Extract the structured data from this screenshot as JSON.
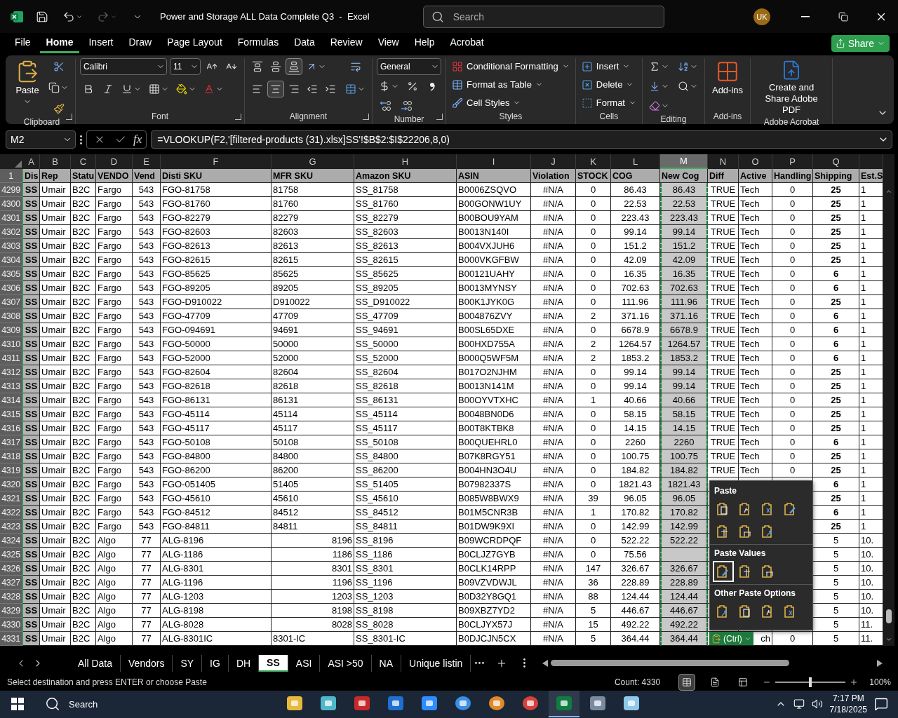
{
  "window": {
    "title": "Power and Storage ALL Data Complete Q3  -  Excel",
    "search_placeholder": "Search",
    "avatar": "UK"
  },
  "menu_tabs": [
    {
      "label": "File",
      "selected": false
    },
    {
      "label": "Home",
      "selected": true
    },
    {
      "label": "Insert",
      "selected": false
    },
    {
      "label": "Draw",
      "selected": false
    },
    {
      "label": "Page Layout",
      "selected": false
    },
    {
      "label": "Formulas",
      "selected": false
    },
    {
      "label": "Data",
      "selected": false
    },
    {
      "label": "Review",
      "selected": false
    },
    {
      "label": "View",
      "selected": false
    },
    {
      "label": "Help",
      "selected": false
    },
    {
      "label": "Acrobat",
      "selected": false
    }
  ],
  "share": "Share",
  "ribbon": [
    {
      "kind": "clipboard",
      "label": "Clipboard",
      "button": "Paste"
    },
    {
      "kind": "font",
      "label": "Font",
      "font_name": "Calibri",
      "font_size": "11"
    },
    {
      "kind": "alignment",
      "label": "Alignment",
      "buttons": [
        {
          "kind": "top",
          "on": false
        },
        {
          "kind": "middle",
          "on": false
        },
        {
          "kind": "bottom",
          "on": true
        },
        {
          "kind": "left",
          "on": false
        },
        {
          "kind": "center",
          "on": true
        },
        {
          "kind": "right",
          "on": false
        },
        {
          "kind": "outdent",
          "on": false
        },
        {
          "kind": "indent",
          "on": false
        }
      ]
    },
    {
      "kind": "number",
      "label": "Number",
      "format": "General"
    },
    {
      "kind": "styles",
      "label": "Styles",
      "items": [
        "Conditional Formatting",
        "Format as Table",
        "Cell Styles"
      ]
    },
    {
      "kind": "cells",
      "label": "Cells",
      "items": [
        "Insert",
        "Delete",
        "Format"
      ]
    },
    {
      "kind": "editing",
      "label": "Editing"
    },
    {
      "kind": "addins",
      "label": "Add-ins",
      "button": "Add-ins"
    },
    {
      "kind": "acrobat",
      "label": "Adobe Acrobat",
      "button": "Create and Share Adobe PDF"
    }
  ],
  "formula_bar": {
    "name_box": "M2",
    "fx": "fx",
    "formula": "=VLOOKUP(F2,'[filtered-products (31).xlsx]SS'!$B$2:$I$22206,8,0)"
  },
  "sheet": {
    "columns": [
      {
        "letter": "A",
        "header": "Dis",
        "selected": false
      },
      {
        "letter": "B",
        "header": "Rep",
        "selected": false
      },
      {
        "letter": "C",
        "header": "Statu",
        "selected": false
      },
      {
        "letter": "D",
        "header": "VENDO",
        "selected": false
      },
      {
        "letter": "E",
        "header": "Vend",
        "selected": false
      },
      {
        "letter": "F",
        "header": "Disti SKU",
        "selected": false
      },
      {
        "letter": "G",
        "header": "MFR SKU",
        "selected": false
      },
      {
        "letter": "H",
        "header": "Amazon SKU",
        "selected": false
      },
      {
        "letter": "I",
        "header": "ASIN",
        "selected": false
      },
      {
        "letter": "J",
        "header": "Violation",
        "selected": false
      },
      {
        "letter": "K",
        "header": "STOCK",
        "selected": false
      },
      {
        "letter": "L",
        "header": "COG",
        "selected": false
      },
      {
        "letter": "M",
        "header": "New Cog",
        "selected": true
      },
      {
        "letter": "N",
        "header": "Diff",
        "selected": false
      },
      {
        "letter": "O",
        "header": "Active",
        "selected": false
      },
      {
        "letter": "P",
        "header": "Handling",
        "selected": false
      },
      {
        "letter": "Q",
        "header": "Shipping",
        "selected": false
      },
      {
        "header": "Est.S",
        "selected": false
      }
    ],
    "header_row": "1",
    "rows": [
      {
        "num": "4299",
        "mfr_numeric": false,
        "shipping_bold": true,
        "cells": [
          "SS",
          "Umair",
          "B2C",
          "Fargo",
          "543",
          "FGO-81758",
          "81758",
          "SS_81758",
          "B0006ZSQVO",
          "#N/A",
          "0",
          "86.43",
          "86.43",
          "TRUE",
          "Tech",
          "0",
          "25",
          "1"
        ]
      },
      {
        "num": "4300",
        "mfr_numeric": false,
        "shipping_bold": true,
        "cells": [
          "SS",
          "Umair",
          "B2C",
          "Fargo",
          "543",
          "FGO-81760",
          "81760",
          "SS_81760",
          "B00GONW1UY",
          "#N/A",
          "0",
          "22.53",
          "22.53",
          "TRUE",
          "Tech",
          "0",
          "25",
          "1"
        ]
      },
      {
        "num": "4301",
        "mfr_numeric": false,
        "shipping_bold": true,
        "cells": [
          "SS",
          "Umair",
          "B2C",
          "Fargo",
          "543",
          "FGO-82279",
          "82279",
          "SS_82279",
          "B00BOU9YAM",
          "#N/A",
          "0",
          "223.43",
          "223.43",
          "TRUE",
          "Tech",
          "0",
          "25",
          "1"
        ]
      },
      {
        "num": "4302",
        "mfr_numeric": false,
        "shipping_bold": true,
        "cells": [
          "SS",
          "Umair",
          "B2C",
          "Fargo",
          "543",
          "FGO-82603",
          "82603",
          "SS_82603",
          "B0013N140I",
          "#N/A",
          "0",
          "99.14",
          "99.14",
          "TRUE",
          "Tech",
          "0",
          "25",
          "1"
        ]
      },
      {
        "num": "4303",
        "mfr_numeric": false,
        "shipping_bold": true,
        "cells": [
          "SS",
          "Umair",
          "B2C",
          "Fargo",
          "543",
          "FGO-82613",
          "82613",
          "SS_82613",
          "B004VXJUH6",
          "#N/A",
          "0",
          "151.2",
          "151.2",
          "TRUE",
          "Tech",
          "0",
          "25",
          "1"
        ]
      },
      {
        "num": "4304",
        "mfr_numeric": false,
        "shipping_bold": true,
        "cells": [
          "SS",
          "Umair",
          "B2C",
          "Fargo",
          "543",
          "FGO-82615",
          "82615",
          "SS_82615",
          "B000VKGFBW",
          "#N/A",
          "0",
          "42.09",
          "42.09",
          "TRUE",
          "Tech",
          "0",
          "25",
          "1"
        ]
      },
      {
        "num": "4305",
        "mfr_numeric": false,
        "shipping_bold": true,
        "cells": [
          "SS",
          "Umair",
          "B2C",
          "Fargo",
          "543",
          "FGO-85625",
          "85625",
          "SS_85625",
          "B00121UAHY",
          "#N/A",
          "0",
          "16.35",
          "16.35",
          "TRUE",
          "Tech",
          "0",
          "6",
          "1"
        ]
      },
      {
        "num": "4306",
        "mfr_numeric": false,
        "shipping_bold": true,
        "cells": [
          "SS",
          "Umair",
          "B2C",
          "Fargo",
          "543",
          "FGO-89205",
          "89205",
          "SS_89205",
          "B0013MYNSY",
          "#N/A",
          "0",
          "702.63",
          "702.63",
          "TRUE",
          "Tech",
          "0",
          "6",
          "1"
        ]
      },
      {
        "num": "4307",
        "mfr_numeric": false,
        "shipping_bold": true,
        "cells": [
          "SS",
          "Umair",
          "B2C",
          "Fargo",
          "543",
          "FGO-D910022",
          "D910022",
          "SS_D910022",
          "B00K1JYK0G",
          "#N/A",
          "0",
          "111.96",
          "111.96",
          "TRUE",
          "Tech",
          "0",
          "25",
          "1"
        ]
      },
      {
        "num": "4308",
        "mfr_numeric": false,
        "shipping_bold": true,
        "cells": [
          "SS",
          "Umair",
          "B2C",
          "Fargo",
          "543",
          "FGO-47709",
          "47709",
          "SS_47709",
          "B004876ZVY",
          "#N/A",
          "2",
          "371.16",
          "371.16",
          "TRUE",
          "Tech",
          "0",
          "6",
          "1"
        ]
      },
      {
        "num": "4309",
        "mfr_numeric": false,
        "shipping_bold": true,
        "cells": [
          "SS",
          "Umair",
          "B2C",
          "Fargo",
          "543",
          "FGO-094691",
          "94691",
          "SS_94691",
          "B00SL65DXE",
          "#N/A",
          "0",
          "6678.9",
          "6678.9",
          "TRUE",
          "Tech",
          "0",
          "6",
          "1"
        ]
      },
      {
        "num": "4310",
        "mfr_numeric": false,
        "shipping_bold": true,
        "cells": [
          "SS",
          "Umair",
          "B2C",
          "Fargo",
          "543",
          "FGO-50000",
          "50000",
          "SS_50000",
          "B00HXD755A",
          "#N/A",
          "2",
          "1264.57",
          "1264.57",
          "TRUE",
          "Tech",
          "0",
          "6",
          "1"
        ]
      },
      {
        "num": "4311",
        "mfr_numeric": false,
        "shipping_bold": true,
        "cells": [
          "SS",
          "Umair",
          "B2C",
          "Fargo",
          "543",
          "FGO-52000",
          "52000",
          "SS_52000",
          "B000Q5WF5M",
          "#N/A",
          "2",
          "1853.2",
          "1853.2",
          "TRUE",
          "Tech",
          "0",
          "6",
          "1"
        ]
      },
      {
        "num": "4312",
        "mfr_numeric": false,
        "shipping_bold": true,
        "cells": [
          "SS",
          "Umair",
          "B2C",
          "Fargo",
          "543",
          "FGO-82604",
          "82604",
          "SS_82604",
          "B017O2NJHM",
          "#N/A",
          "0",
          "99.14",
          "99.14",
          "TRUE",
          "Tech",
          "0",
          "25",
          "1"
        ]
      },
      {
        "num": "4313",
        "mfr_numeric": false,
        "shipping_bold": true,
        "cells": [
          "SS",
          "Umair",
          "B2C",
          "Fargo",
          "543",
          "FGO-82618",
          "82618",
          "SS_82618",
          "B0013N141M",
          "#N/A",
          "0",
          "99.14",
          "99.14",
          "TRUE",
          "Tech",
          "0",
          "25",
          "1"
        ]
      },
      {
        "num": "4314",
        "mfr_numeric": false,
        "shipping_bold": true,
        "cells": [
          "SS",
          "Umair",
          "B2C",
          "Fargo",
          "543",
          "FGO-86131",
          "86131",
          "SS_86131",
          "B00OYVTXHC",
          "#N/A",
          "1",
          "40.66",
          "40.66",
          "TRUE",
          "Tech",
          "0",
          "25",
          "1"
        ]
      },
      {
        "num": "4315",
        "mfr_numeric": false,
        "shipping_bold": true,
        "cells": [
          "SS",
          "Umair",
          "B2C",
          "Fargo",
          "543",
          "FGO-45114",
          "45114",
          "SS_45114",
          "B0048BN0D6",
          "#N/A",
          "0",
          "58.15",
          "58.15",
          "TRUE",
          "Tech",
          "0",
          "25",
          "1"
        ]
      },
      {
        "num": "4316",
        "mfr_numeric": false,
        "shipping_bold": true,
        "cells": [
          "SS",
          "Umair",
          "B2C",
          "Fargo",
          "543",
          "FGO-45117",
          "45117",
          "SS_45117",
          "B00T8KTBK8",
          "#N/A",
          "0",
          "14.15",
          "14.15",
          "TRUE",
          "Tech",
          "0",
          "25",
          "1"
        ]
      },
      {
        "num": "4317",
        "mfr_numeric": false,
        "shipping_bold": true,
        "cells": [
          "SS",
          "Umair",
          "B2C",
          "Fargo",
          "543",
          "FGO-50108",
          "50108",
          "SS_50108",
          "B00QUEHRL0",
          "#N/A",
          "0",
          "2260",
          "2260",
          "TRUE",
          "Tech",
          "0",
          "6",
          "1"
        ]
      },
      {
        "num": "4318",
        "mfr_numeric": false,
        "shipping_bold": true,
        "cells": [
          "SS",
          "Umair",
          "B2C",
          "Fargo",
          "543",
          "FGO-84800",
          "84800",
          "SS_84800",
          "B07K8RGY51",
          "#N/A",
          "0",
          "100.75",
          "100.75",
          "TRUE",
          "Tech",
          "0",
          "25",
          "1"
        ]
      },
      {
        "num": "4319",
        "mfr_numeric": false,
        "shipping_bold": true,
        "cells": [
          "SS",
          "Umair",
          "B2C",
          "Fargo",
          "543",
          "FGO-86200",
          "86200",
          "SS_86200",
          "B004HN3O4U",
          "#N/A",
          "0",
          "184.82",
          "184.82",
          "TRUE",
          "Tech",
          "0",
          "25",
          "1"
        ]
      },
      {
        "num": "4320",
        "mfr_numeric": false,
        "shipping_bold": true,
        "cells": [
          "SS",
          "Umair",
          "B2C",
          "Fargo",
          "543",
          "FGO-051405",
          "51405",
          "SS_51405",
          "B07982337S",
          "#N/A",
          "0",
          "1821.43",
          "1821.43",
          null,
          null,
          null,
          "6",
          "1"
        ]
      },
      {
        "num": "4321",
        "mfr_numeric": false,
        "shipping_bold": true,
        "cells": [
          "SS",
          "Umair",
          "B2C",
          "Fargo",
          "543",
          "FGO-45610",
          "45610",
          "SS_45610",
          "B085W8BWX9",
          "#N/A",
          "39",
          "96.05",
          "96.05",
          null,
          null,
          null,
          "25",
          "1"
        ]
      },
      {
        "num": "4322",
        "mfr_numeric": false,
        "shipping_bold": true,
        "cells": [
          "SS",
          "Umair",
          "B2C",
          "Fargo",
          "543",
          "FGO-84512",
          "84512",
          "SS_84512",
          "B01M5CNR3B",
          "#N/A",
          "1",
          "170.82",
          "170.82",
          null,
          null,
          null,
          "6",
          "1"
        ]
      },
      {
        "num": "4323",
        "mfr_numeric": false,
        "shipping_bold": true,
        "cells": [
          "SS",
          "Umair",
          "B2C",
          "Fargo",
          "543",
          "FGO-84811",
          "84811",
          "SS_84811",
          "B01DW9K9XI",
          "#N/A",
          "0",
          "142.99",
          "142.99",
          null,
          null,
          null,
          "25",
          "1"
        ]
      },
      {
        "num": "4324",
        "mfr_numeric": true,
        "shipping_bold": false,
        "cells": [
          "SS",
          "Umair",
          "B2C",
          "Algo",
          "77",
          "ALG-8196",
          "8196",
          "SS_8196",
          "B09WCRDPQF",
          "#N/A",
          "0",
          "522.22",
          "522.22",
          null,
          null,
          null,
          "5",
          "10."
        ]
      },
      {
        "num": "4325",
        "mfr_numeric": true,
        "shipping_bold": false,
        "cells": [
          "SS",
          "Umair",
          "B2C",
          "Algo",
          "77",
          "ALG-1186",
          "1186",
          "SS_1186",
          "B0CLJZ7GYB",
          "#N/A",
          "0",
          "75.56",
          null,
          null,
          null,
          null,
          "5",
          "10."
        ]
      },
      {
        "num": "4326",
        "mfr_numeric": true,
        "shipping_bold": false,
        "cells": [
          "SS",
          "Umair",
          "B2C",
          "Algo",
          "77",
          "ALG-8301",
          "8301",
          "SS_8301",
          "B0CLK14RPP",
          "#N/A",
          "147",
          "326.67",
          "326.67",
          null,
          null,
          null,
          "5",
          "10."
        ]
      },
      {
        "num": "4327",
        "mfr_numeric": true,
        "shipping_bold": false,
        "cells": [
          "SS",
          "Umair",
          "B2C",
          "Algo",
          "77",
          "ALG-1196",
          "1196",
          "SS_1196",
          "B09VZVDWJL",
          "#N/A",
          "36",
          "228.89",
          "228.89",
          null,
          null,
          null,
          "5",
          "10."
        ]
      },
      {
        "num": "4328",
        "mfr_numeric": true,
        "shipping_bold": false,
        "cells": [
          "SS",
          "Umair",
          "B2C",
          "Algo",
          "77",
          "ALG-1203",
          "1203",
          "SS_1203",
          "B0D32Y8GQ1",
          "#N/A",
          "88",
          "124.44",
          "124.44",
          null,
          null,
          null,
          "5",
          "10."
        ]
      },
      {
        "num": "4329",
        "mfr_numeric": true,
        "shipping_bold": false,
        "cells": [
          "SS",
          "Umair",
          "B2C",
          "Algo",
          "77",
          "ALG-8198",
          "8198",
          "SS_8198",
          "B09XBZ7YD2",
          "#N/A",
          "5",
          "446.67",
          "446.67",
          null,
          null,
          null,
          "5",
          "10."
        ]
      },
      {
        "num": "4330",
        "mfr_numeric": true,
        "shipping_bold": false,
        "cells": [
          "SS",
          "Umair",
          "B2C",
          "Algo",
          "77",
          "ALG-8028",
          "8028",
          "SS_8028",
          "B0CLJYX57J",
          "#N/A",
          "15",
          "492.22",
          "492.22",
          null,
          null,
          null,
          "5",
          "11."
        ]
      },
      {
        "num": "4331",
        "mfr_numeric": false,
        "shipping_bold": false,
        "cells": [
          "SS",
          "Umair",
          "B2C",
          "Algo",
          "77",
          "ALG-8301IC",
          "8301-IC",
          "SS_8301-IC",
          "B0DJCJN5CX",
          "#N/A",
          "5",
          "364.44",
          "364.44",
          null,
          "ch",
          "0",
          "5",
          "11."
        ]
      }
    ]
  },
  "paste_menu": {
    "sections": [
      {
        "title": "Paste",
        "options": [
          {
            "selected": false
          },
          {
            "selected": false
          },
          {
            "selected": false
          },
          {
            "selected": false
          },
          {
            "selected": false
          },
          {
            "selected": false
          },
          {
            "selected": false
          }
        ]
      },
      {
        "title": "Paste Values",
        "options": [
          {
            "selected": true
          },
          {
            "selected": false
          },
          {
            "selected": false
          }
        ]
      },
      {
        "title": "Other Paste Options",
        "options": [
          {
            "selected": false
          },
          {
            "selected": false
          },
          {
            "selected": false
          },
          {
            "selected": false
          }
        ]
      }
    ],
    "ctrl_label": "(Ctrl)"
  },
  "sheet_tabs": [
    {
      "label": "All Data",
      "selected": false
    },
    {
      "label": "Vendors",
      "selected": false
    },
    {
      "label": "SY",
      "selected": false
    },
    {
      "label": "IG",
      "selected": false
    },
    {
      "label": "DH",
      "selected": false
    },
    {
      "label": "SS",
      "selected": true
    },
    {
      "label": "ASI",
      "selected": false
    },
    {
      "label": "ASI >50",
      "selected": false
    },
    {
      "label": "NA",
      "selected": false
    },
    {
      "label": "Unique listin",
      "selected": false
    }
  ],
  "status_bar": {
    "message": "Select destination and press ENTER or choose Paste",
    "count": "Count: 4330",
    "zoom": {
      "level": 0.5
    },
    "zoom_label": "100%"
  },
  "taskbar": {
    "search": "Search",
    "time": "7:17 PM",
    "date": "7/18/2025"
  }
}
